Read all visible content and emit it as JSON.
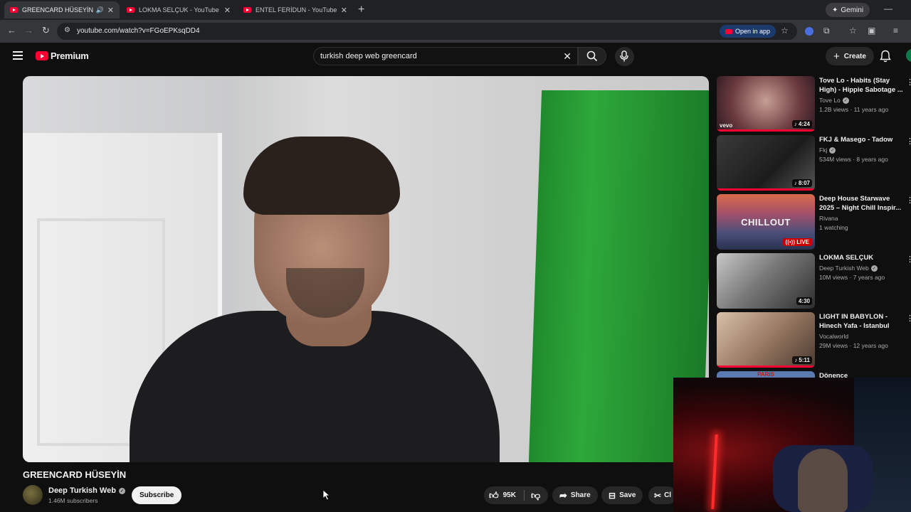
{
  "browser": {
    "tabs": [
      {
        "title": "GREENCARD HÜSEYİN - Yo",
        "active": true
      },
      {
        "title": "LOKMA SELÇUK - YouTube",
        "active": false
      },
      {
        "title": "ENTEL FERİDUN - YouTube",
        "active": false
      }
    ],
    "gemini_label": "Gemini",
    "url": "youtube.com/watch?v=FGoEPKsqDD4",
    "open_in_app_label": "Open in app"
  },
  "youtube": {
    "logo_text": "Premium",
    "search_value": "turkish deep web greencard",
    "create_label": "Create"
  },
  "video": {
    "title": "GREENCARD HÜSEYİN",
    "channel_name": "Deep Turkish Web",
    "subscribers": "1.46M subscribers",
    "subscribe_label": "Subscribe",
    "likes": "95K",
    "share_label": "Share",
    "save_label": "Save",
    "clip_label": "Cl"
  },
  "recommendations": [
    {
      "title": "Tove Lo - Habits (Stay High) - Hippie Sabotage ...",
      "channel": "Tove Lo",
      "verified": true,
      "meta": "1.2B views · 11 years ago",
      "duration": "4:24",
      "thumb_badge": "vevo"
    },
    {
      "title": "FKJ & Masego - Tadow",
      "channel": "Fkj",
      "verified": true,
      "meta": "534M views · 8 years ago",
      "duration": "8:07"
    },
    {
      "title": "Deep House Starwave 2025 – Night Chill Inspir...",
      "channel": "Rivana",
      "verified": false,
      "meta": "1 watching",
      "live_label": "LIVE",
      "thumb_text": "CHILLOUT"
    },
    {
      "title": "LOKMA SELÇUK",
      "channel": "Deep Turkish Web",
      "verified": true,
      "meta": "10M views · 7 years ago",
      "duration": "4:30"
    },
    {
      "title": "LIGHT IN BABYLON - Hinech Yafa    -    Istanbul",
      "channel": "Vocalworld",
      "verified": false,
      "meta": "29M views · 12 years ago",
      "duration": "5:11"
    },
    {
      "title": "Dönence",
      "thumb_text": "PARIS"
    }
  ],
  "colors": {
    "youtube_red": "#ff0033",
    "background": "#0f0f0f",
    "greenscreen": "#2ea83a"
  }
}
